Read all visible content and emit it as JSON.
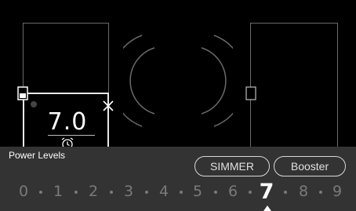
{
  "zone": {
    "power_value": "7.0"
  },
  "bottom_panel": {
    "title": "Power Levels",
    "simmer_label": "SIMMER",
    "booster_label": "Booster"
  },
  "levels": [
    "0",
    "1",
    "2",
    "3",
    "4",
    "5",
    "6",
    "7",
    "8",
    "9"
  ],
  "selected_level": "7",
  "icons": {
    "close": "close-icon",
    "timer": "alarm-clock-icon",
    "zone_indicator": "zone-select-icon",
    "heat_waves": "heat-waves-icon"
  },
  "colors": {
    "background": "#000000",
    "panel": "#333333",
    "text": "#ffffff",
    "inactive_level": "#7a7a7a"
  }
}
